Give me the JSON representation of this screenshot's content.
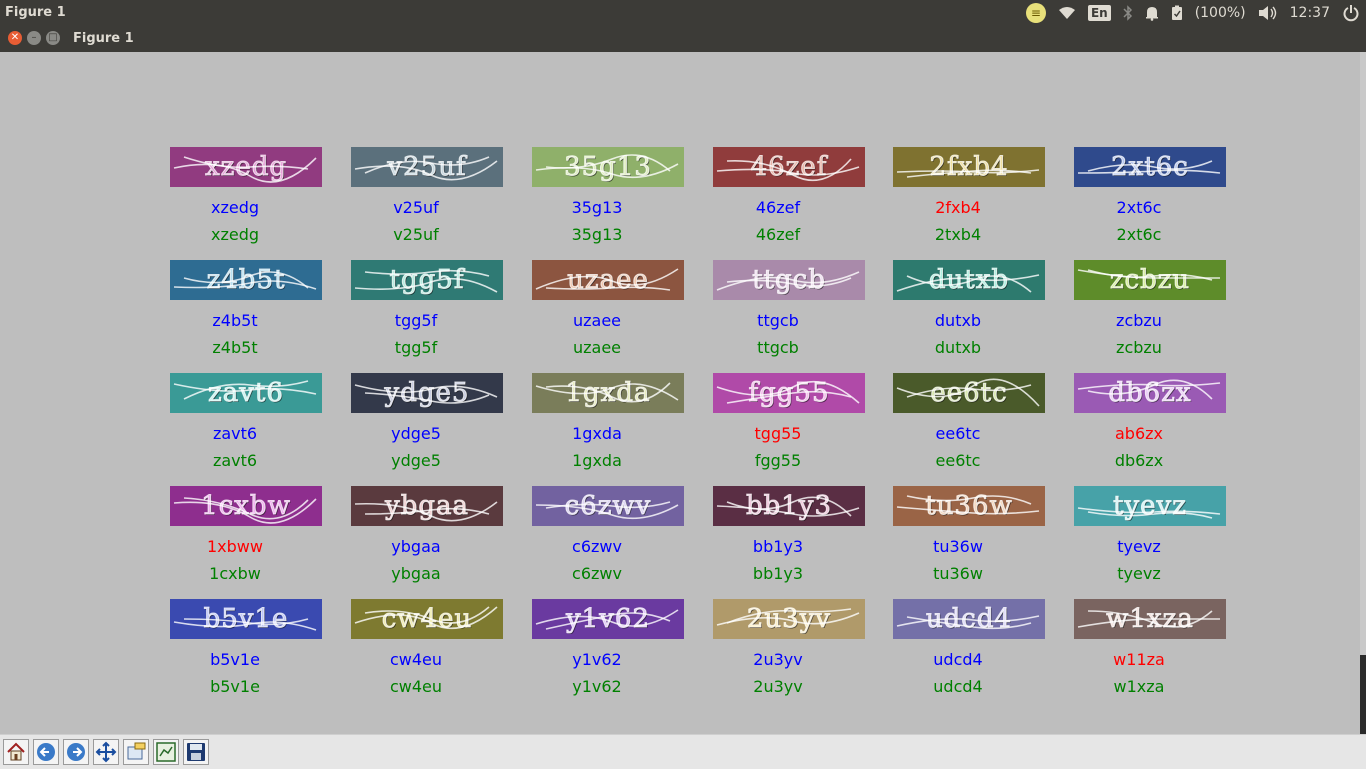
{
  "system_bar": {
    "app_title": "Figure 1",
    "indicators": {
      "record_icon": "≡",
      "wifi_icon": "wifi-icon",
      "keyboard_layout": "En",
      "bluetooth_icon": "bluetooth-icon",
      "bell_icon": "bell-icon",
      "battery": "(100%)",
      "clock": "12:37"
    }
  },
  "window": {
    "title": "Figure 1"
  },
  "colors": {
    "pred_correct": "#0000ff",
    "pred_wrong": "#ff0000",
    "truth": "#008000"
  },
  "captchas": [
    {
      "image_text": "xzedg",
      "bg": "#913b80",
      "fg": "#e6a0d8",
      "pred": "xzedg",
      "truth": "xzedg",
      "wrong": false
    },
    {
      "image_text": "v25uf",
      "bg": "#5b707c",
      "fg": "#c8d8e0",
      "pred": "v25uf",
      "truth": "v25uf",
      "wrong": false
    },
    {
      "image_text": "35g13",
      "bg": "#8fb06a",
      "fg": "#dfeebf",
      "pred": "35g13",
      "truth": "35g13",
      "wrong": false
    },
    {
      "image_text": "46zef",
      "bg": "#903c3c",
      "fg": "#e8b4a8",
      "pred": "46zef",
      "truth": "46zef",
      "wrong": false
    },
    {
      "image_text": "2fxb4",
      "bg": "#7f7230",
      "fg": "#f0e0a0",
      "pred": "2fxb4",
      "truth": "2txb4",
      "wrong": true
    },
    {
      "image_text": "2xt6c",
      "bg": "#2f4a8c",
      "fg": "#b8c8f0",
      "pred": "2xt6c",
      "truth": "2xt6c",
      "wrong": false
    },
    {
      "image_text": "z4b5t",
      "bg": "#2e6c92",
      "fg": "#b8e0f0",
      "pred": "z4b5t",
      "truth": "z4b5t",
      "wrong": false
    },
    {
      "image_text": "tgg5f",
      "bg": "#2f7a74",
      "fg": "#b8ece0",
      "pred": "tgg5f",
      "truth": "tgg5f",
      "wrong": false
    },
    {
      "image_text": "uzaee",
      "bg": "#8c5540",
      "fg": "#f0c8b0",
      "pred": "uzaee",
      "truth": "uzaee",
      "wrong": false
    },
    {
      "image_text": "ttgcb",
      "bg": "#a98aaa",
      "fg": "#f0e0f0",
      "pred": "ttgcb",
      "truth": "ttgcb",
      "wrong": false
    },
    {
      "image_text": "dutxb",
      "bg": "#2d7a6e",
      "fg": "#b0f0e0",
      "pred": "dutxb",
      "truth": "dutxb",
      "wrong": false
    },
    {
      "image_text": "zcbzu",
      "bg": "#5e8c2a",
      "fg": "#d8f0a0",
      "pred": "zcbzu",
      "truth": "zcbzu",
      "wrong": false
    },
    {
      "image_text": "zavt6",
      "bg": "#3a9a96",
      "fg": "#c8f4f0",
      "pred": "zavt6",
      "truth": "zavt6",
      "wrong": false
    },
    {
      "image_text": "ydge5",
      "bg": "#33394a",
      "fg": "#c8cce0",
      "pred": "ydge5",
      "truth": "ydge5",
      "wrong": false
    },
    {
      "image_text": "1gxda",
      "bg": "#7a7d5a",
      "fg": "#e8ecc0",
      "pred": "1gxda",
      "truth": "1gxda",
      "wrong": false
    },
    {
      "image_text": "fgg55",
      "bg": "#b04aa8",
      "fg": "#f4c0ec",
      "pred": "tgg55",
      "truth": "fgg55",
      "wrong": true
    },
    {
      "image_text": "ee6tc",
      "bg": "#4a5a2a",
      "fg": "#d8e8b0",
      "pred": "ee6tc",
      "truth": "ee6tc",
      "wrong": false
    },
    {
      "image_text": "db6zx",
      "bg": "#9a5ab4",
      "fg": "#ecd0f8",
      "pred": "ab6zx",
      "truth": "db6zx",
      "wrong": true
    },
    {
      "image_text": "1cxbw",
      "bg": "#8e2e8e",
      "fg": "#f0b0f0",
      "pred": "1xbww",
      "truth": "1cxbw",
      "wrong": true
    },
    {
      "image_text": "ybgaa",
      "bg": "#5a3a3e",
      "fg": "#f0d0d0",
      "pred": "ybgaa",
      "truth": "ybgaa",
      "wrong": false
    },
    {
      "image_text": "c6zwv",
      "bg": "#7262a0",
      "fg": "#dcd4f4",
      "pred": "c6zwv",
      "truth": "c6zwv",
      "wrong": false
    },
    {
      "image_text": "bb1y3",
      "bg": "#5a2e44",
      "fg": "#f0c8dc",
      "pred": "bb1y3",
      "truth": "bb1y3",
      "wrong": false
    },
    {
      "image_text": "tu36w",
      "bg": "#9a6446",
      "fg": "#f4d8c0",
      "pred": "tu36w",
      "truth": "tu36w",
      "wrong": false
    },
    {
      "image_text": "tyevz",
      "bg": "#47a2a8",
      "fg": "#d4f4f4",
      "pred": "tyevz",
      "truth": "tyevz",
      "wrong": false
    },
    {
      "image_text": "b5v1e",
      "bg": "#3a4ab0",
      "fg": "#c0c8f8",
      "pred": "b5v1e",
      "truth": "b5v1e",
      "wrong": false
    },
    {
      "image_text": "cw4eu",
      "bg": "#7e7a30",
      "fg": "#f0ecb0",
      "pred": "cw4eu",
      "truth": "cw4eu",
      "wrong": false
    },
    {
      "image_text": "y1v62",
      "bg": "#6a3aa0",
      "fg": "#e0c8f8",
      "pred": "y1v62",
      "truth": "y1v62",
      "wrong": false
    },
    {
      "image_text": "2u3yv",
      "bg": "#b09a6a",
      "fg": "#fcf0c8",
      "pred": "2u3yv",
      "truth": "2u3yv",
      "wrong": false
    },
    {
      "image_text": "udcd4",
      "bg": "#7470a8",
      "fg": "#e0dcf8",
      "pred": "udcd4",
      "truth": "udcd4",
      "wrong": false
    },
    {
      "image_text": "w1xza",
      "bg": "#7a6460",
      "fg": "#f4e4e0",
      "pred": "w11za",
      "truth": "w1xza",
      "wrong": true
    }
  ],
  "toolbar": {
    "buttons": [
      {
        "name": "home-button",
        "icon": "home-icon"
      },
      {
        "name": "back-button",
        "icon": "arrow-left-icon"
      },
      {
        "name": "forward-button",
        "icon": "arrow-right-icon"
      },
      {
        "name": "pan-button",
        "icon": "move-icon"
      },
      {
        "name": "zoom-button",
        "icon": "zoom-rect-icon"
      },
      {
        "name": "configure-subplots-button",
        "icon": "subplots-icon"
      },
      {
        "name": "save-button",
        "icon": "floppy-icon"
      }
    ]
  }
}
